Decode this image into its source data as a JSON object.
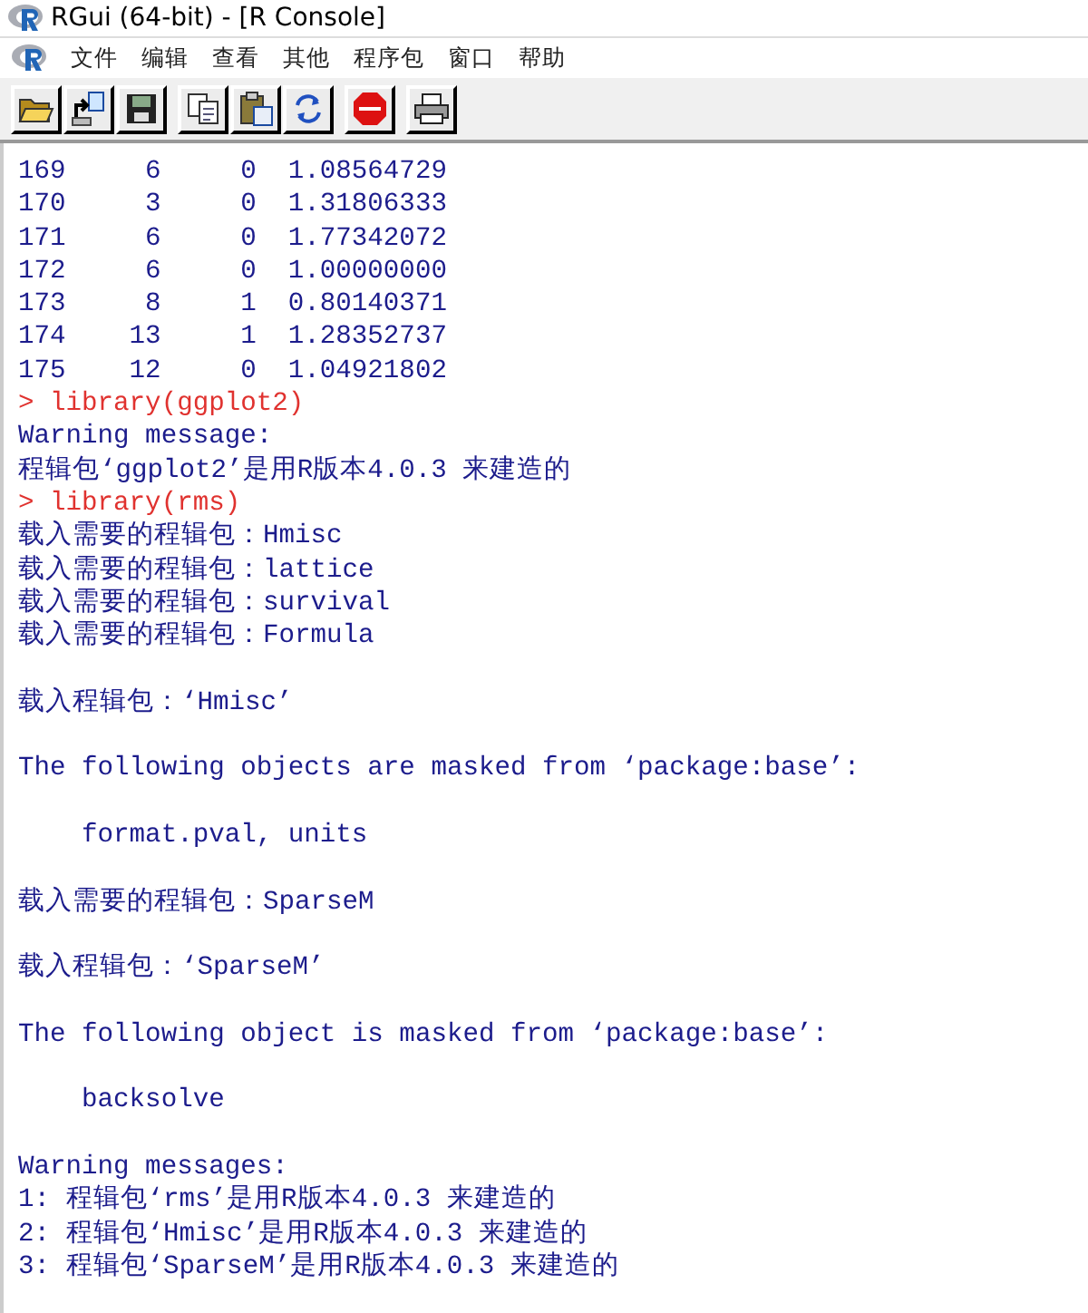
{
  "window": {
    "title": "RGui (64-bit) - [R Console]"
  },
  "menu": [
    "文件",
    "编辑",
    "查看",
    "其他",
    "程序包",
    "窗口",
    "帮助"
  ],
  "toolbar": [
    {
      "kind": "open"
    },
    {
      "kind": "load"
    },
    {
      "kind": "save"
    },
    {
      "kind": "copy"
    },
    {
      "kind": "paste"
    },
    {
      "kind": "refresh"
    },
    {
      "kind": "stop"
    },
    {
      "kind": "print"
    }
  ],
  "console": [
    {
      "kind": "output",
      "text": "169     6     0  1.08564729"
    },
    {
      "kind": "output",
      "text": "170     3     0  1.31806333"
    },
    {
      "kind": "output",
      "text": "171     6     0  1.77342072"
    },
    {
      "kind": "output",
      "text": "172     6     0  1.00000000"
    },
    {
      "kind": "output",
      "text": "173     8     1  0.80140371"
    },
    {
      "kind": "output",
      "text": "174    13     1  1.28352737"
    },
    {
      "kind": "output",
      "text": "175    12     0  1.04921802"
    },
    {
      "kind": "input",
      "text": "> library(ggplot2)"
    },
    {
      "kind": "output",
      "text": "Warning message:"
    },
    {
      "kind": "output",
      "text": "程辑包‘ggplot2’是用R版本4.0.3 来建造的"
    },
    {
      "kind": "input",
      "text": "> library(rms)"
    },
    {
      "kind": "output",
      "text": "载入需要的程辑包：Hmisc"
    },
    {
      "kind": "output",
      "text": "载入需要的程辑包：lattice"
    },
    {
      "kind": "output",
      "text": "载入需要的程辑包：survival"
    },
    {
      "kind": "output",
      "text": "载入需要的程辑包：Formula"
    },
    {
      "kind": "output",
      "text": "载入程辑包：‘Hmisc’",
      "gap_before": true
    },
    {
      "kind": "output",
      "text": "The following objects are masked from ‘package:base’:",
      "gap_before": true
    },
    {
      "kind": "output",
      "text": "    format.pval, units",
      "gap_before": true
    },
    {
      "kind": "output",
      "text": "载入需要的程辑包：SparseM",
      "gap_before": true
    },
    {
      "kind": "output",
      "text": "载入程辑包：‘SparseM’",
      "gap_before": true
    },
    {
      "kind": "output",
      "text": "The following object is masked from ‘package:base’:",
      "gap_before": true
    },
    {
      "kind": "output",
      "text": "    backsolve",
      "gap_before": true
    },
    {
      "kind": "output",
      "text": "Warning messages:",
      "gap_before": true
    },
    {
      "kind": "output",
      "text": "1: 程辑包‘rms’是用R版本4.0.3 来建造的"
    },
    {
      "kind": "output",
      "text": "2: 程辑包‘Hmisc’是用R版本4.0.3 来建造的"
    },
    {
      "kind": "output",
      "text": "3: 程辑包‘SparseM’是用R版本4.0.3 来建造的"
    }
  ]
}
